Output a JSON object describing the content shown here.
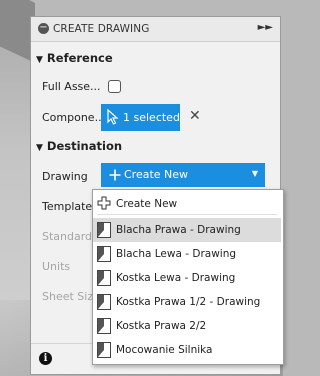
{
  "panel": {
    "title": "CREATE DRAWING",
    "collapse_glyph": "−",
    "expand_glyph": "►►"
  },
  "reference": {
    "heading": "Reference",
    "full_assembly_label": "Full Asse...",
    "full_assembly_checked": false,
    "components_label": "Compone...",
    "selection_text": "1 selected",
    "clear_glyph": "✕"
  },
  "destination": {
    "heading": "Destination",
    "drawing_label": "Drawing",
    "drawing_value": "Create New",
    "template_label": "Template",
    "standard_label": "Standard",
    "units_label": "Units",
    "sheet_size_label": "Sheet Size"
  },
  "menu": {
    "items": [
      {
        "label": "Create New",
        "icon": "plus-icon"
      },
      {
        "label": "Blacha Prawa -  Drawing",
        "icon": "drawing-doc-icon",
        "highlighted": true
      },
      {
        "label": "Blacha Lewa - Drawing",
        "icon": "drawing-doc-icon"
      },
      {
        "label": "Kostka Lewa - Drawing",
        "icon": "drawing-doc-icon"
      },
      {
        "label": "Kostka Prawa 1/2 - Drawing",
        "icon": "drawing-doc-icon"
      },
      {
        "label": "Kostka Prawa 2/2",
        "icon": "drawing-doc-icon"
      },
      {
        "label": "Mocowanie Silnika",
        "icon": "drawing-doc-icon"
      }
    ]
  },
  "colors": {
    "accent": "#1c8ee0",
    "panel_bg": "#f1f1f1",
    "highlight": "#dcdcdc"
  }
}
